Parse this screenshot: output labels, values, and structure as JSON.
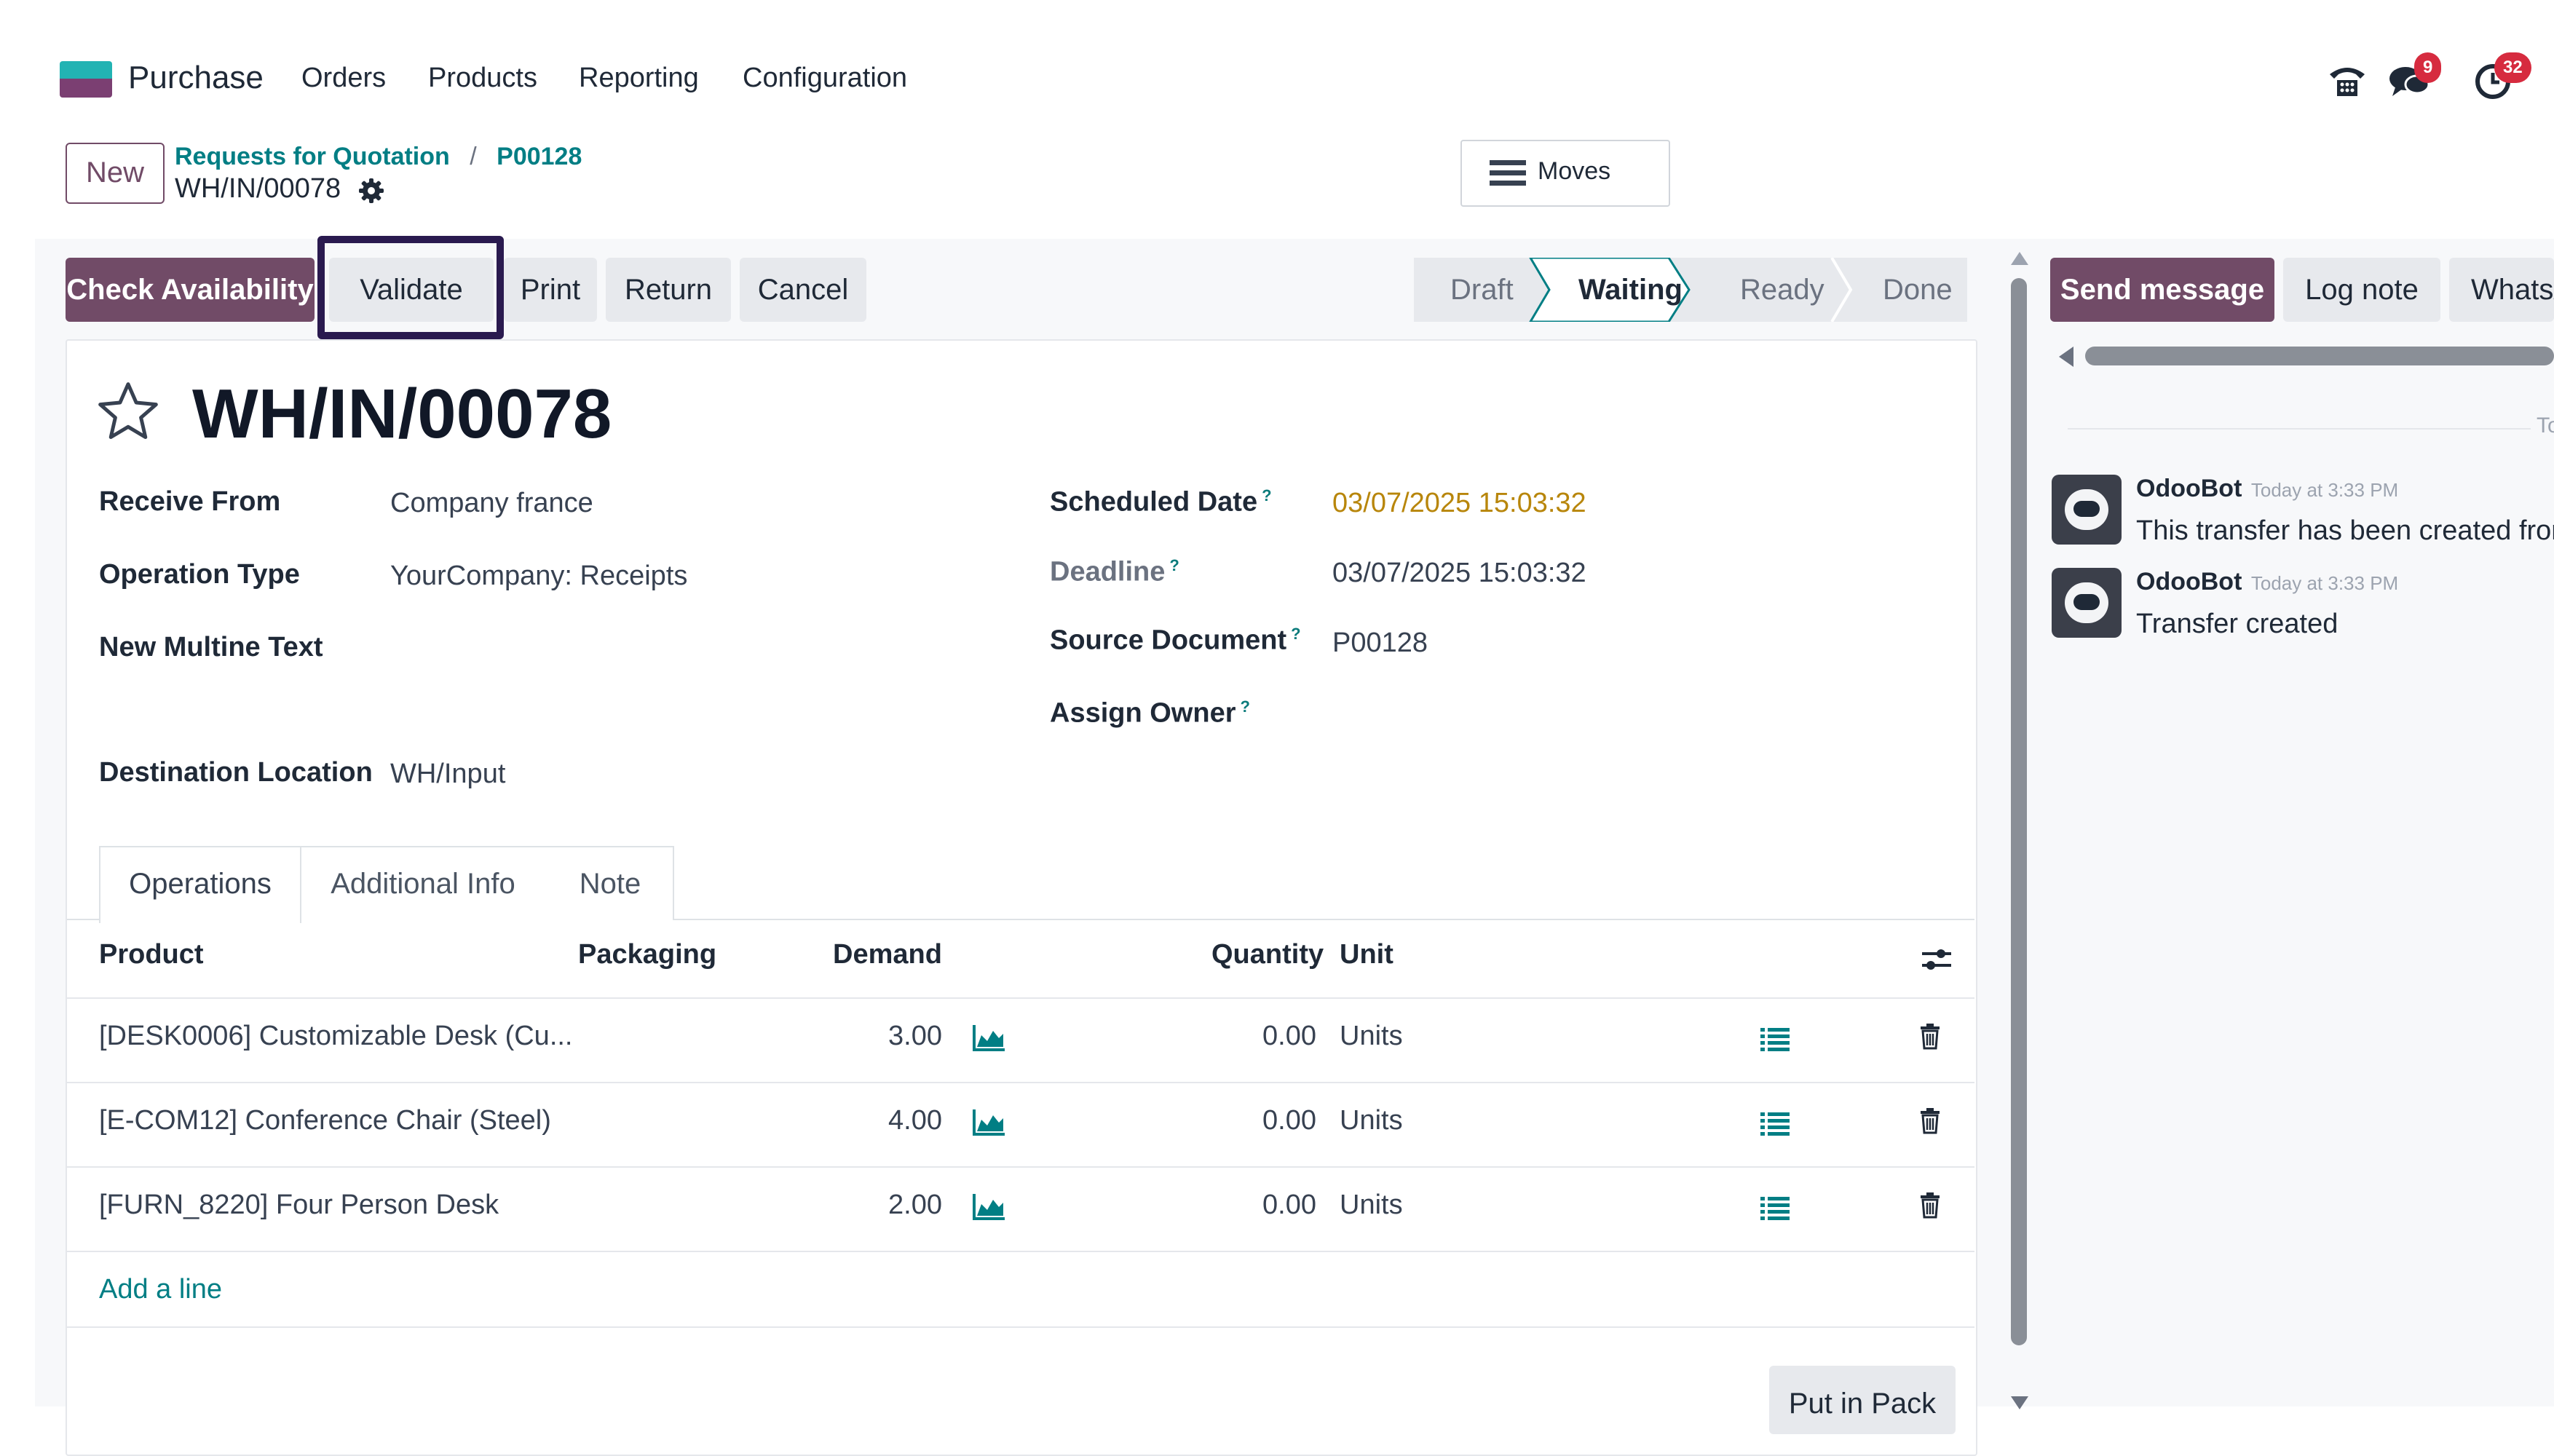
{
  "topnav": {
    "app_name": "Purchase",
    "menu": [
      "Orders",
      "Products",
      "Reporting",
      "Configuration"
    ],
    "messages_badge": "9",
    "activities_badge": "32"
  },
  "breadcrumb": {
    "new_button": "New",
    "parent": "Requests for Quotation",
    "separator": "/",
    "order": "P00128",
    "current": "WH/IN/00078"
  },
  "smart_button": {
    "label": "Moves"
  },
  "actions": {
    "check_availability": "Check Availability",
    "validate": "Validate",
    "print": "Print",
    "return": "Return",
    "cancel": "Cancel"
  },
  "status": [
    "Draft",
    "Waiting",
    "Ready",
    "Done"
  ],
  "form": {
    "title": "WH/IN/00078",
    "receive_from_label": "Receive From",
    "receive_from": "Company france",
    "operation_type_label": "Operation Type",
    "operation_type": "YourCompany: Receipts",
    "multiline_label": "New Multine Text",
    "destination_label": "Destination Location",
    "destination": "WH/Input",
    "scheduled_label": "Scheduled Date",
    "scheduled": "03/07/2025 15:03:32",
    "deadline_label": "Deadline",
    "deadline": "03/07/2025 15:03:32",
    "source_label": "Source Document",
    "source": "P00128",
    "owner_label": "Assign Owner",
    "help_mark": "?"
  },
  "tabs": [
    "Operations",
    "Additional Info",
    "Note"
  ],
  "table": {
    "headers": {
      "product": "Product",
      "packaging": "Packaging",
      "demand": "Demand",
      "quantity": "Quantity",
      "unit": "Unit"
    },
    "rows": [
      {
        "product": "[DESK0006] Customizable Desk (Cu...",
        "demand": "3.00",
        "quantity": "0.00",
        "unit": "Units"
      },
      {
        "product": "[E-COM12] Conference Chair (Steel)",
        "demand": "4.00",
        "quantity": "0.00",
        "unit": "Units"
      },
      {
        "product": "[FURN_8220] Four Person Desk",
        "demand": "2.00",
        "quantity": "0.00",
        "unit": "Units"
      }
    ],
    "add_line": "Add a line",
    "put_in_pack": "Put in Pack"
  },
  "chatter": {
    "send_message": "Send message",
    "log_note": "Log note",
    "whatsapp": "WhatsA",
    "date_divider": "To",
    "messages": [
      {
        "author": "OdooBot",
        "time": "Today at 3:33 PM",
        "text": "This transfer has been created fror"
      },
      {
        "author": "OdooBot",
        "time": "Today at 3:33 PM",
        "text": "Transfer created"
      }
    ]
  },
  "colors": {
    "primary": "#714b67",
    "teal": "#017e84",
    "highlight_box": "#2a1a4f",
    "scheduled_date": "#b8860b"
  }
}
